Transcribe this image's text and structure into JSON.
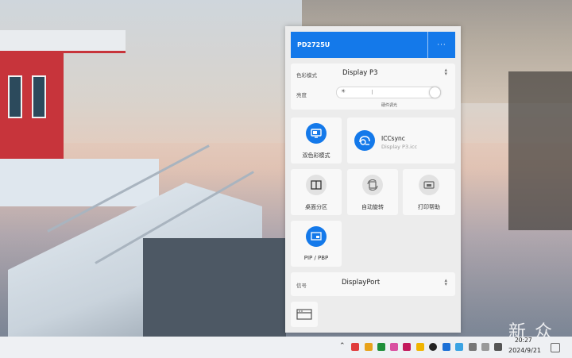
{
  "panel": {
    "monitor_name": "PD2725U",
    "more_label": "···",
    "color_mode": {
      "label": "色彩模式",
      "value": "Display P3"
    },
    "brightness": {
      "label": "亮度",
      "level_fraction": 1.0,
      "hardware_label": "硬件调光"
    },
    "tiles": {
      "dual_color": {
        "label": "双色彩模式",
        "icon": "monitor-icon"
      },
      "iccsync": {
        "title": "ICCsync",
        "subtitle": "Display P3.icc",
        "icon": "icc-sync-icon"
      },
      "desktop_partition": {
        "label": "桌面分区",
        "icon": "split-window-icon"
      },
      "auto_rotate": {
        "label": "自动旋转",
        "icon": "rotate-screen-icon"
      },
      "print_help": {
        "label": "打印帮助",
        "icon": "print-icon"
      },
      "pip_pbp": {
        "label": "PIP / PBP",
        "icon": "pip-icon"
      }
    },
    "signal": {
      "label": "信号",
      "value": "DisplayPort"
    },
    "accent_color": "#1479ea"
  },
  "taskbar": {
    "time": "20:27",
    "date": "2024/9/21"
  },
  "watermark": "新 众"
}
